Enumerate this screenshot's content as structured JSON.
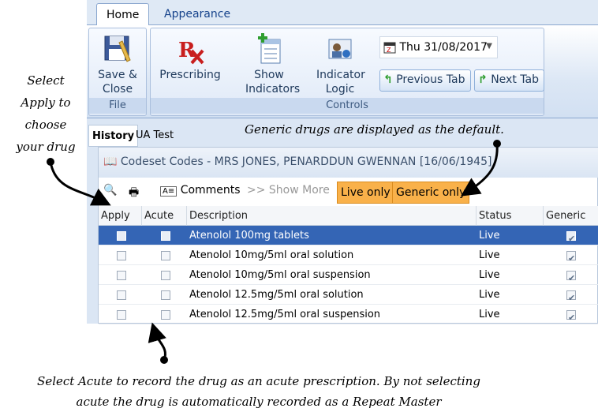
{
  "ribbon": {
    "tabs": [
      "Home",
      "Appearance"
    ],
    "buttons": {
      "save_close": "Save & Close",
      "prescribing": "Prescribing",
      "show_indicators": "Show Indicators",
      "indicator_logic": "Indicator Logic",
      "previous_tab": "Previous Tab",
      "next_tab": "Next Tab"
    },
    "date_value": "Thu 31/08/2017",
    "groups": {
      "file": "File",
      "controls": "Controls"
    }
  },
  "doc_tabs": [
    "History",
    "UA Test"
  ],
  "codeset": {
    "title": "Codeset Codes - MRS JONES, PENARDDUN GWENNAN [16/06/1945]",
    "toolbar": {
      "comments": "Comments",
      "show_more": ">> Show More",
      "live_only": "Live only",
      "generic_only": "Generic only"
    }
  },
  "grid": {
    "headers": [
      "Apply",
      "Acute",
      "Description",
      "Status",
      "Generic"
    ],
    "rows": [
      {
        "description": "Atenolol 100mg tablets",
        "status": "Live",
        "generic": true,
        "selected": true
      },
      {
        "description": "Atenolol 10mg/5ml oral solution",
        "status": "Live",
        "generic": true,
        "selected": false
      },
      {
        "description": "Atenolol 10mg/5ml oral suspension",
        "status": "Live",
        "generic": true,
        "selected": false
      },
      {
        "description": "Atenolol 12.5mg/5ml oral solution",
        "status": "Live",
        "generic": true,
        "selected": false
      },
      {
        "description": "Atenolol 12.5mg/5ml oral suspension",
        "status": "Live",
        "generic": true,
        "selected": false
      }
    ]
  },
  "annotations": {
    "apply_note": [
      "Select",
      "Apply to",
      "choose",
      "your drug"
    ],
    "generic_note": "Generic drugs are displayed as the default.",
    "acute_note": [
      "Select Acute to record the drug as an acute prescription. By not selecting",
      "acute the drug is automatically recorded as a Repeat Master"
    ]
  },
  "colors": {
    "selected_row": "#3465b5",
    "filter_button": "#f9b14a",
    "ribbon_text": "#1e395b"
  },
  "icons": [
    "save-icon",
    "prescription-icon",
    "show-indicators-icon",
    "indicator-logic-icon",
    "calendar-icon",
    "previous-tab-icon",
    "next-tab-icon",
    "book-icon",
    "preview-icon",
    "print-icon",
    "comments-icon"
  ]
}
